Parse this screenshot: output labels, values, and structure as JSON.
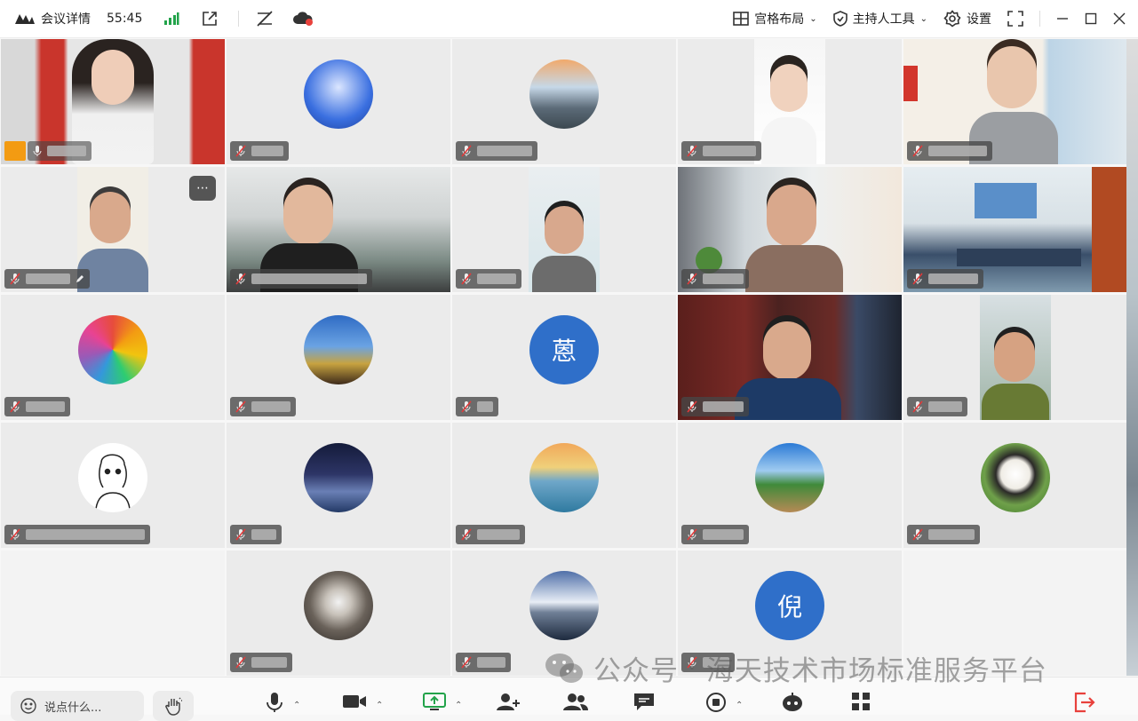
{
  "topbar": {
    "meeting_details": "会议详情",
    "timer": "55:45",
    "layout_label": "宫格布局",
    "host_tools_label": "主持人工具",
    "settings_label": "设置"
  },
  "tiles": {
    "t11_letter": "蒽",
    "t18_letter": "倪"
  },
  "bottombar": {
    "chat_placeholder": "说点什么..."
  },
  "watermark": {
    "prefix": "公众号",
    "name": "海天技术市场标准服务平台"
  },
  "colors": {
    "accent_blue": "#2f6fc9",
    "host_orange": "#f39b12",
    "signal_green": "#22a34a",
    "leave_red": "#e8413c",
    "mute_red": "#e23b3b"
  }
}
